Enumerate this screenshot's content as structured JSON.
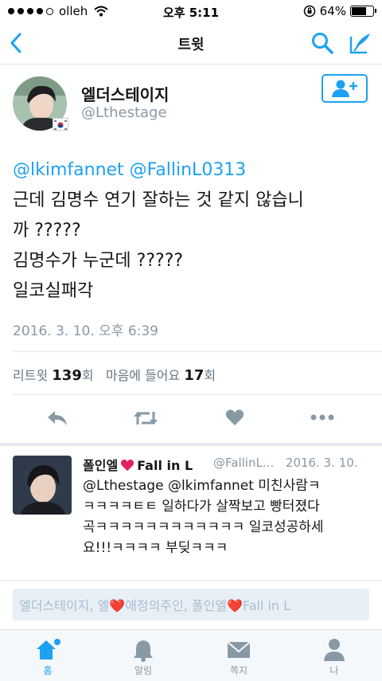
{
  "status_bar": {
    "carrier": "olleh",
    "time": "오후 5:11",
    "battery": "64%"
  },
  "nav": {
    "title": "트윗"
  },
  "tweet": {
    "author_name": "엘더스테이지",
    "author_handle": "@Lthestage",
    "text_lines": [
      "@lkimfannet @FallinL0313",
      "근데 김명수 연기 잘하는 것 같지 않습니",
      "까 ?????",
      "김명수가 누군데 ?????",
      "일코실패각"
    ],
    "timestamp": "2016. 3. 10. 오후 6:39",
    "retweets_label": "리트윗",
    "retweets_count": "139",
    "retweets_unit": "회",
    "likes_label": "마음에 들어요",
    "likes_count": "17",
    "likes_unit": "회"
  },
  "reply": {
    "author_name": "폴인엘",
    "author_name_suffix": "Fall in L",
    "author_handle": "@FallinL...",
    "date": "2016. 3. 10.",
    "text_lines": [
      "@Lthestage @lkimfannet 미친사람ㅋ",
      "ㅋㅋㅋㅋㅌㅌ 일하다가 살짝보고 빵터졌다",
      "곡ㅋㅋㅋㅋㅋㅋㅋㅋㅋㅋㅋㅋ 일코성공하세",
      "요!!!ㅋㅋㅋㅋ 부딪ㅋㅋㅋ"
    ]
  },
  "reply_box": {
    "placeholder": "엘더스테이지, 엘❤️애정의주인, 폴인엘❤️Fall in L"
  },
  "tabs": [
    {
      "label": "홈",
      "icon": "home-icon"
    },
    {
      "label": "알림",
      "icon": "bell-icon"
    },
    {
      "label": "쪽지",
      "icon": "envelope-icon"
    },
    {
      "label": "나",
      "icon": "person-icon"
    }
  ],
  "colors": {
    "accent": "#1da1f2",
    "heart": "#e0245e",
    "muted": "#8899a6"
  }
}
